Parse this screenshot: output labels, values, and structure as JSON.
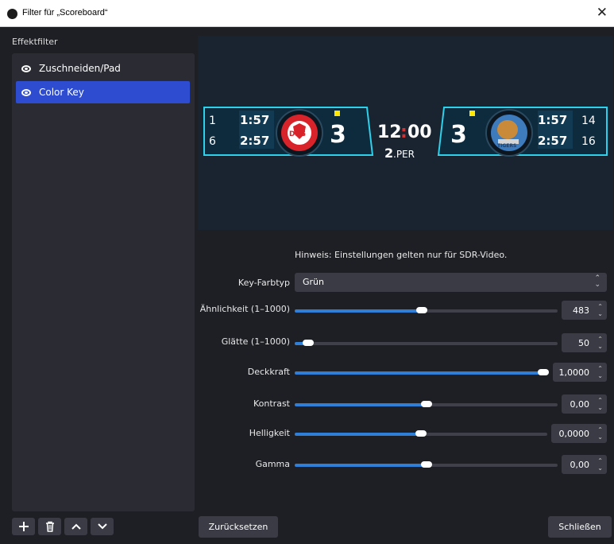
{
  "window": {
    "title": "Filter für „Scoreboard“",
    "close_glyph": "✕"
  },
  "sidebar": {
    "label": "Effektfilter",
    "filters": [
      {
        "name": "Zuschneiden/Pad",
        "visible": true,
        "selected": false
      },
      {
        "name": "Color Key",
        "visible": true,
        "selected": true
      }
    ],
    "toolbar": [
      "plus-icon",
      "trash-icon",
      "chevron-up-icon",
      "chevron-down-icon"
    ]
  },
  "scoreboard": {
    "left": {
      "penalty_nums": [
        "1",
        "6"
      ],
      "penalty_times": [
        "1:57",
        "2:57"
      ],
      "score": "3",
      "logo": "DEG"
    },
    "center": {
      "clock_min": "12",
      "clock_sep": ":",
      "clock_sec": "00",
      "period_num": "2",
      "period_label": ".PER"
    },
    "right": {
      "penalty_nums": [
        "14",
        "16"
      ],
      "penalty_times": [
        "1:57",
        "2:57"
      ],
      "score": "3",
      "logo": "TIGERS"
    }
  },
  "settings": {
    "hint": "Hinweis: Einstellungen gelten nur für SDR-Video.",
    "key_color_type": {
      "label": "Key-Farbtyp",
      "value": "Grün"
    },
    "sliders": [
      {
        "label": "Ähnlichkeit (1–1000)",
        "value": "483",
        "fraction": 0.483
      },
      {
        "label": "Glätte (1–1000)",
        "value": "50",
        "fraction": 0.05
      },
      {
        "label": "Deckkraft",
        "value": "1,0000",
        "fraction": 1.0
      },
      {
        "label": "Kontrast",
        "value": "0,00",
        "fraction": 0.5
      },
      {
        "label": "Helligkeit",
        "value": "0,0000",
        "fraction": 0.5
      },
      {
        "label": "Gamma",
        "value": "0,00",
        "fraction": 0.5
      }
    ]
  },
  "buttons": {
    "reset": "Zurücksetzen",
    "close": "Schließen"
  },
  "colors": {
    "accent": "#2f7ed8",
    "selection": "#2d4ccf",
    "panel": "#2b2c33",
    "background": "#1e1f24"
  }
}
